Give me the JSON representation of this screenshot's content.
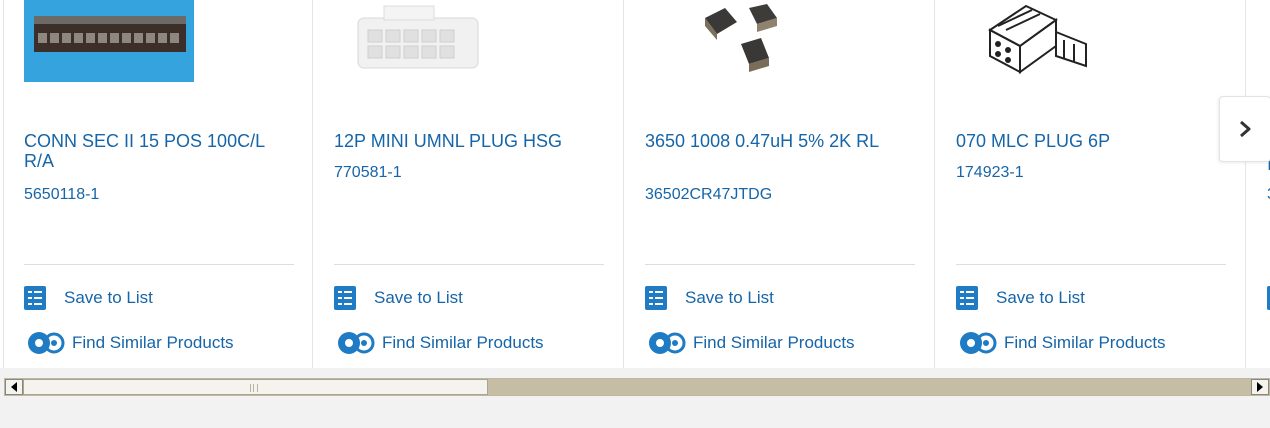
{
  "products": [
    {
      "title": "CONN SEC II 15 POS 100C/L R/A",
      "part_number": "5650118-1",
      "image": "edge-connector-image",
      "save_label": "Save to List",
      "similar_label": "Find Similar Products"
    },
    {
      "title": "12P MINI UMNL PLUG HSG",
      "part_number": "770581-1",
      "image": "plug-housing-image",
      "save_label": "Save to List",
      "similar_label": "Find Similar Products"
    },
    {
      "title": "3650 1008 0.47uH 5% 2K RL",
      "part_number": "36502CR47JTDG",
      "image": "inductor-image",
      "save_label": "Save to List",
      "similar_label": "Find Similar Products"
    },
    {
      "title": "070 MLC PLUG 6P",
      "part_number": "174923-1",
      "image": "mlc-plug-image",
      "save_label": "Save to List",
      "similar_label": "Find Similar Products"
    },
    {
      "title": "I",
      "part_number": "3"
    }
  ],
  "carousel": {
    "next_icon": "chevron-right-icon"
  },
  "colors": {
    "link": "#1665a8",
    "icon": "#1e7bc4"
  }
}
